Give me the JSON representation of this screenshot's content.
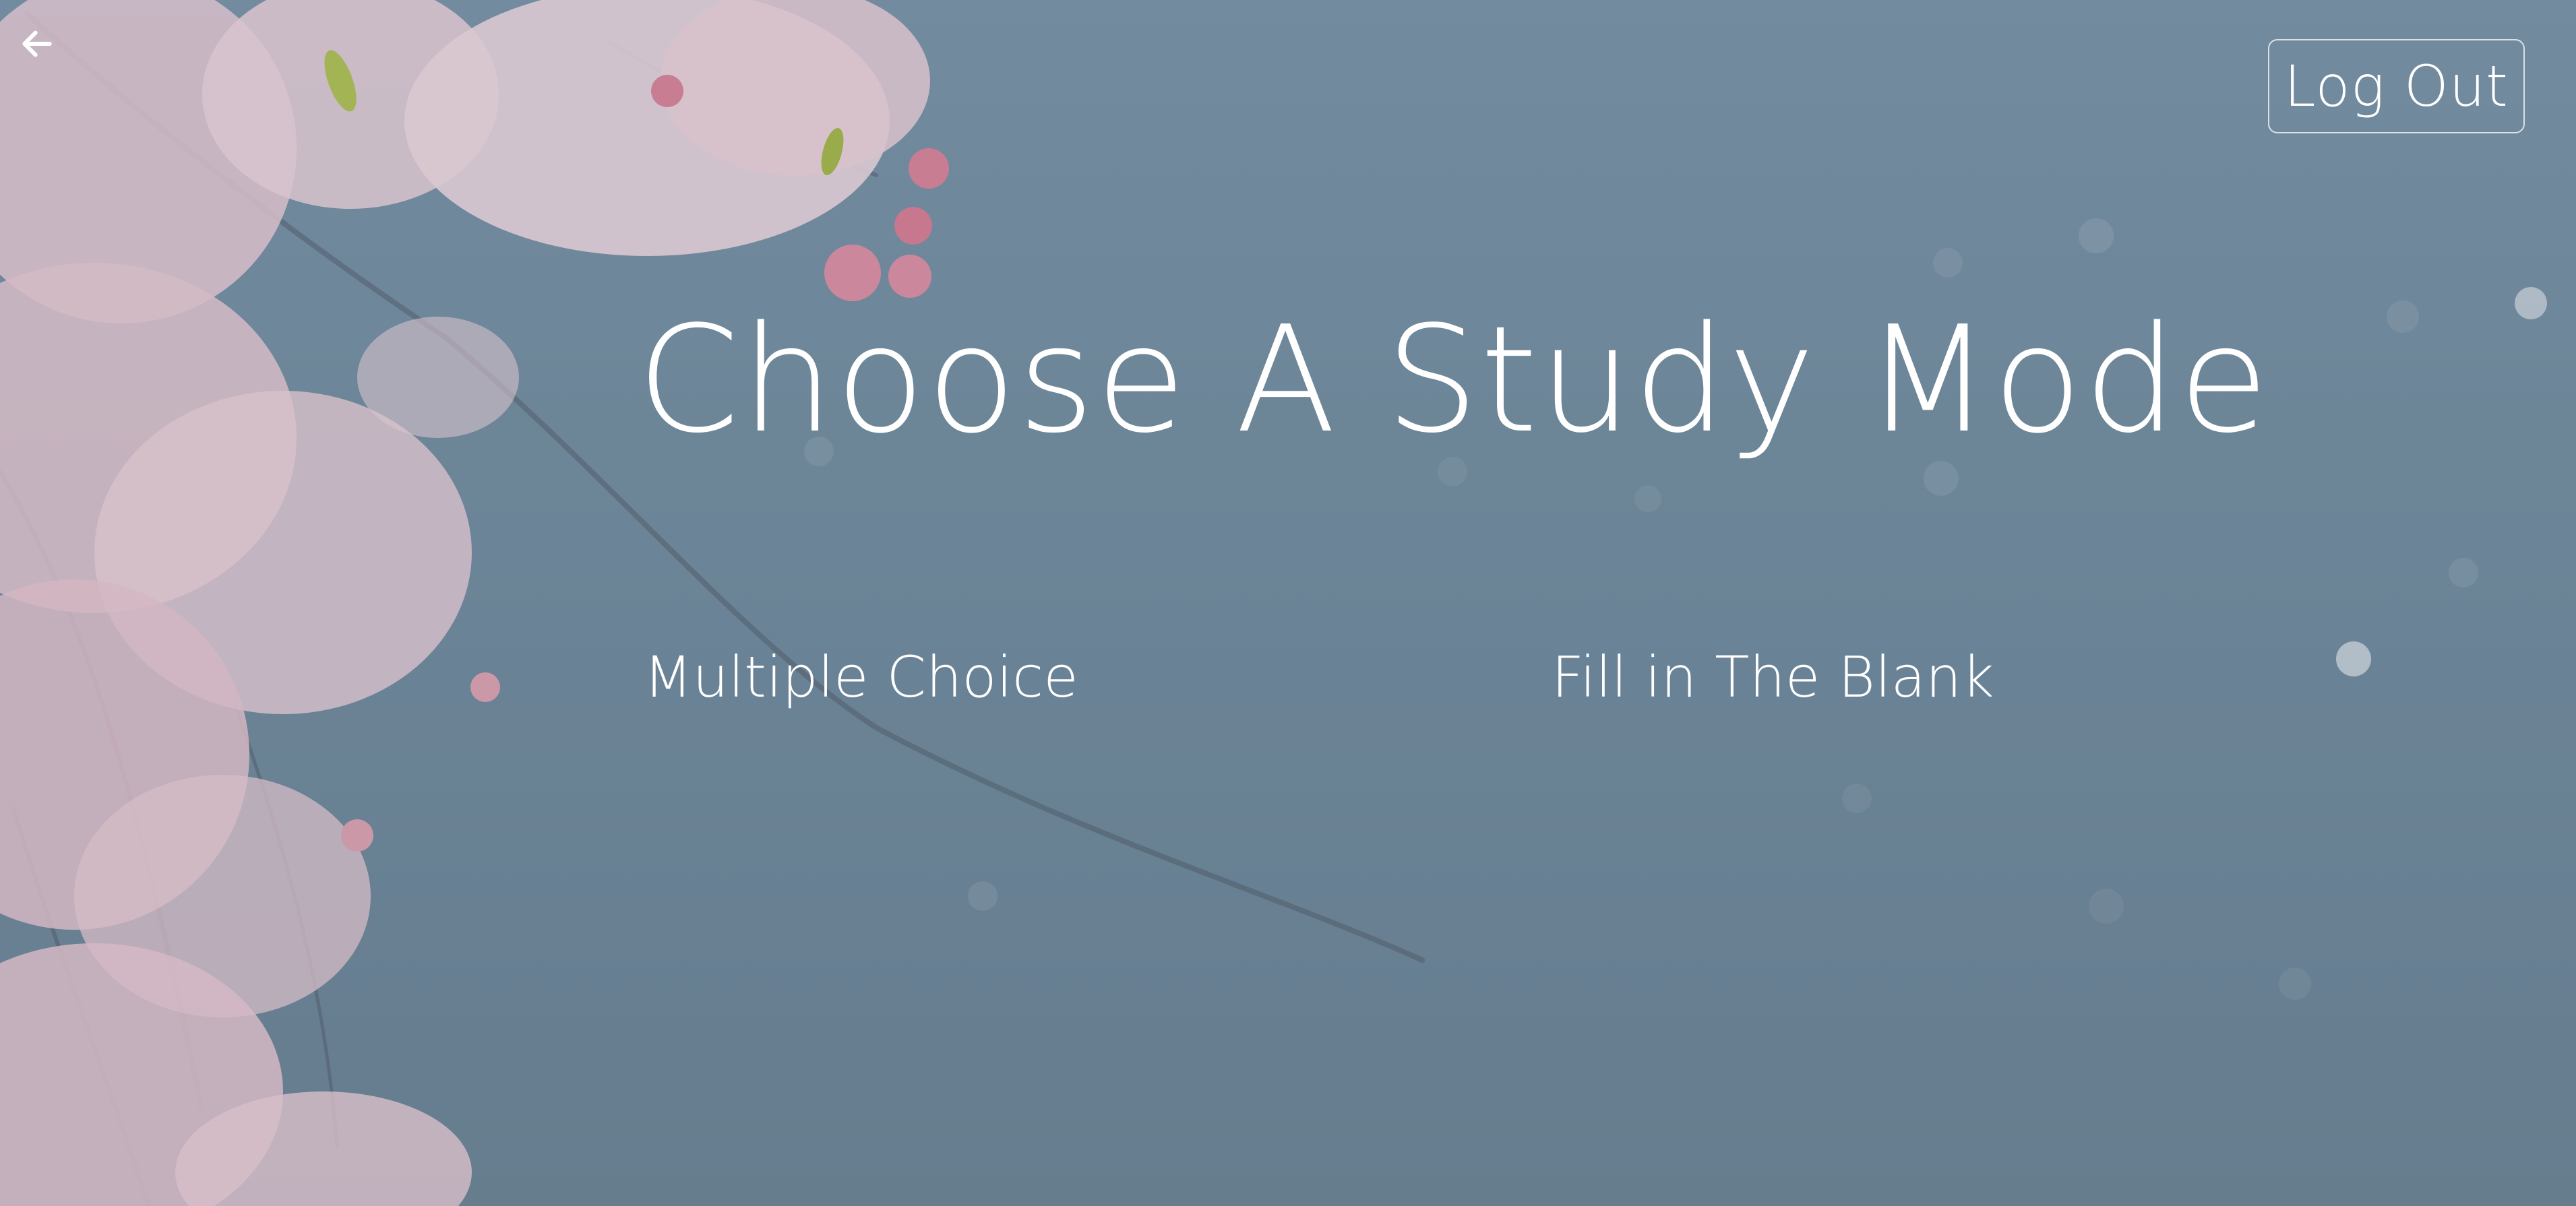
{
  "header": {
    "back_icon": "arrow-left-icon",
    "logout_label": "Log Out"
  },
  "main": {
    "title": "Choose A Study Mode",
    "modes": [
      {
        "label": "Multiple Choice"
      },
      {
        "label": "Fill in The Blank"
      }
    ]
  },
  "colors": {
    "background": "#7890a5",
    "text": "#ffffff",
    "blossom": "#f4d3db"
  }
}
